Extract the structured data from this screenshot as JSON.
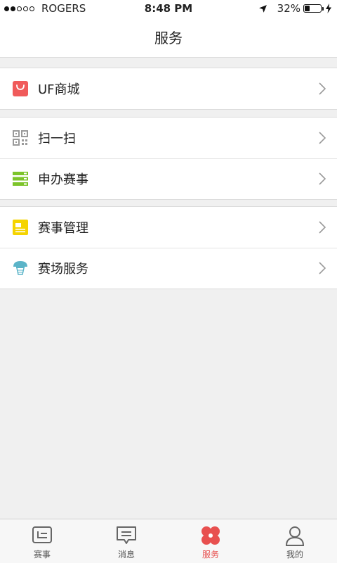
{
  "status_bar": {
    "carrier": "ROGERS",
    "time": "8:48 PM",
    "battery_percent": "32%",
    "battery_level": 0.32,
    "signal_bars_filled": 2,
    "signal_bars_total": 5
  },
  "nav": {
    "title": "服务"
  },
  "menu": {
    "groups": [
      {
        "items": [
          {
            "label": "UF商城",
            "icon": "shopping-bag-icon",
            "icon_color": "#f05b5b"
          }
        ]
      },
      {
        "items": [
          {
            "label": "扫一扫",
            "icon": "qr-code-icon",
            "icon_color": "#9a9a9a"
          },
          {
            "label": "申办赛事",
            "icon": "server-list-icon",
            "icon_color": "#7cc42a"
          }
        ]
      },
      {
        "items": [
          {
            "label": "赛事管理",
            "icon": "clipboard-icon",
            "icon_color": "#f5d400"
          },
          {
            "label": "赛场服务",
            "icon": "basketball-hoop-icon",
            "icon_color": "#5bb4c8"
          }
        ]
      }
    ]
  },
  "tabs": [
    {
      "label": "赛事",
      "icon": "ticket-icon",
      "active": false
    },
    {
      "label": "消息",
      "icon": "message-icon",
      "active": false
    },
    {
      "label": "服务",
      "icon": "clover-icon",
      "active": true
    },
    {
      "label": "我的",
      "icon": "person-icon",
      "active": false
    }
  ],
  "colors": {
    "accent": "#e8504f",
    "chevron": "#9a9a9a",
    "background": "#f0f0f0"
  }
}
